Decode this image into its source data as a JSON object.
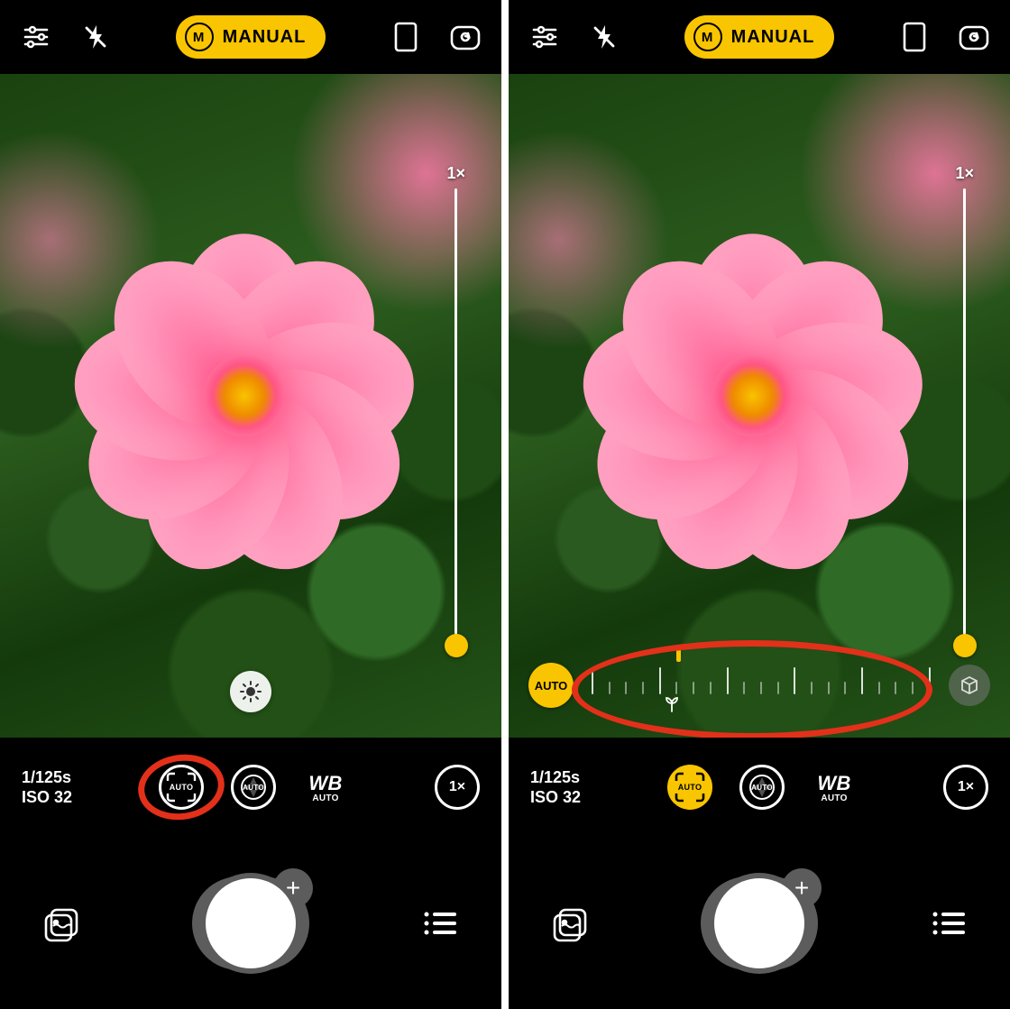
{
  "mode": {
    "badge_letter": "M",
    "label": "MANUAL"
  },
  "zoom": {
    "label": "1×"
  },
  "exposure": {
    "shutter": "1/125s",
    "iso": "ISO 32"
  },
  "controls": {
    "focus_label": "AUTO",
    "exposure_label": "AUTO",
    "wb_label": "WB",
    "wb_sub": "AUTO",
    "zoom_chip": "1×"
  },
  "focus_overlay": {
    "auto_chip": "AUTO"
  },
  "shutter": {
    "plus": "+"
  }
}
